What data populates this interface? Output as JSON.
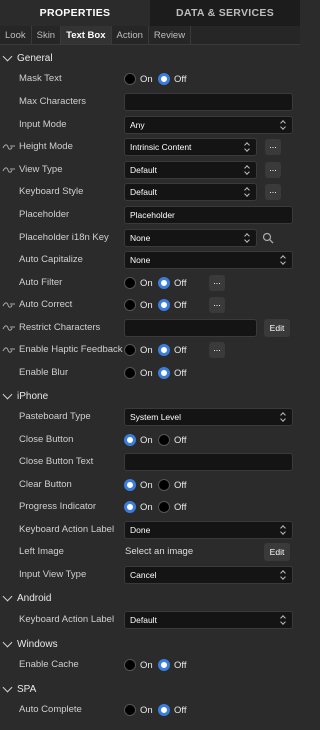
{
  "top_tabs": {
    "properties": "PROPERTIES",
    "data_services": "DATA & SERVICES"
  },
  "sub_tabs": [
    "Look",
    "Skin",
    "Text Box",
    "Action",
    "Review"
  ],
  "sections": {
    "general": "General",
    "iphone": "iPhone",
    "android": "Android",
    "windows": "Windows",
    "spa": "SPA"
  },
  "general": {
    "mask_text": {
      "label": "Mask Text",
      "on": "On",
      "off": "Off",
      "selected": "Off"
    },
    "max_characters": {
      "label": "Max Characters",
      "value": ""
    },
    "input_mode": {
      "label": "Input Mode",
      "value": "Any"
    },
    "height_mode": {
      "label": "Height Mode",
      "value": "Intrinsic Content",
      "more": "..."
    },
    "view_type": {
      "label": "View Type",
      "value": "Default",
      "more": "..."
    },
    "keyboard_style": {
      "label": "Keyboard Style",
      "value": "Default",
      "more": "..."
    },
    "placeholder": {
      "label": "Placeholder",
      "value": "Placeholder"
    },
    "placeholder_i18n": {
      "label": "Placeholder i18n Key",
      "value": "None"
    },
    "auto_capitalize": {
      "label": "Auto Capitalize",
      "value": "None"
    },
    "auto_filter": {
      "label": "Auto Filter",
      "on": "On",
      "off": "Off",
      "selected": "Off",
      "more": "..."
    },
    "auto_correct": {
      "label": "Auto Correct",
      "on": "On",
      "off": "Off",
      "selected": "Off",
      "more": "..."
    },
    "restrict_characters": {
      "label": "Restrict Characters",
      "value": "",
      "edit": "Edit"
    },
    "enable_haptic": {
      "label": "Enable Haptic Feedback",
      "on": "On",
      "off": "Off",
      "selected": "Off",
      "more": "..."
    },
    "enable_blur": {
      "label": "Enable Blur",
      "on": "On",
      "off": "Off",
      "selected": "Off"
    }
  },
  "iphone": {
    "pasteboard_type": {
      "label": "Pasteboard Type",
      "value": "System Level"
    },
    "close_button": {
      "label": "Close Button",
      "on": "On",
      "off": "Off",
      "selected": "On"
    },
    "close_button_text": {
      "label": "Close Button Text",
      "value": ""
    },
    "clear_button": {
      "label": "Clear Button",
      "on": "On",
      "off": "Off",
      "selected": "On"
    },
    "progress_indicator": {
      "label": "Progress Indicator",
      "on": "On",
      "off": "Off",
      "selected": "On"
    },
    "keyboard_action_label": {
      "label": "Keyboard Action Label",
      "value": "Done"
    },
    "left_image": {
      "label": "Left Image",
      "value": "Select an image",
      "edit": "Edit"
    },
    "input_view_type": {
      "label": "Input View Type",
      "value": "Cancel"
    }
  },
  "android": {
    "keyboard_action_label": {
      "label": "Keyboard Action Label",
      "value": "Default"
    }
  },
  "windows": {
    "enable_cache": {
      "label": "Enable Cache",
      "on": "On",
      "off": "Off",
      "selected": "Off"
    }
  },
  "spa": {
    "auto_complete": {
      "label": "Auto Complete",
      "on": "On",
      "off": "Off",
      "selected": "Off"
    }
  },
  "colors": {
    "accent": "#3b7ddd",
    "panel_bg": "#2b2b2b",
    "field_bg": "#141414"
  }
}
